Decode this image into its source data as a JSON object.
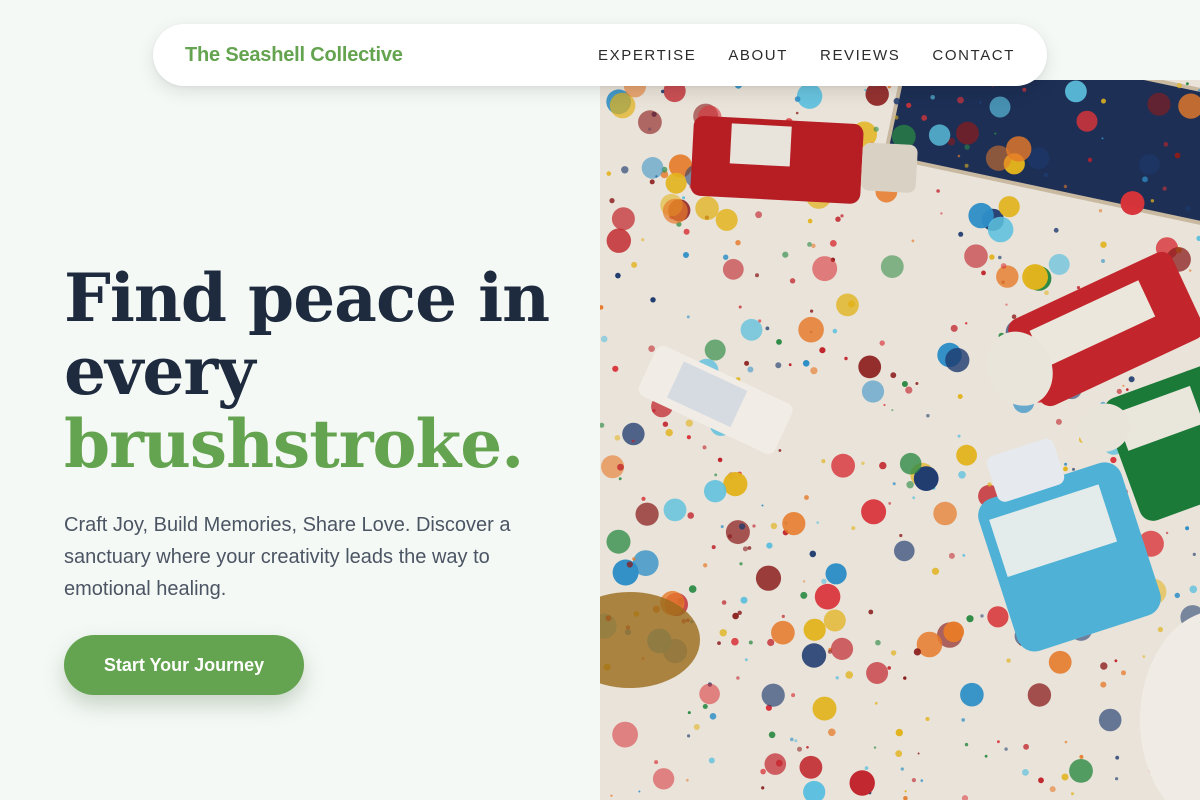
{
  "nav": {
    "brand": "The Seashell Collective",
    "links": [
      "EXPERTISE",
      "ABOUT",
      "REVIEWS",
      "CONTACT"
    ]
  },
  "hero": {
    "headline_line1": "Find peace in",
    "headline_line2": "every",
    "headline_accent": "brushstroke.",
    "subtext": "Craft Joy, Build Memories, Share Love. Discover a sanctuary where your creativity leads the way to emotional healing.",
    "cta_label": "Start Your Journey"
  },
  "colors": {
    "accent_green": "#64a34f",
    "headline_navy": "#1e2a3d",
    "body_gray": "#4b5563",
    "page_background": "#f5f9f6"
  }
}
